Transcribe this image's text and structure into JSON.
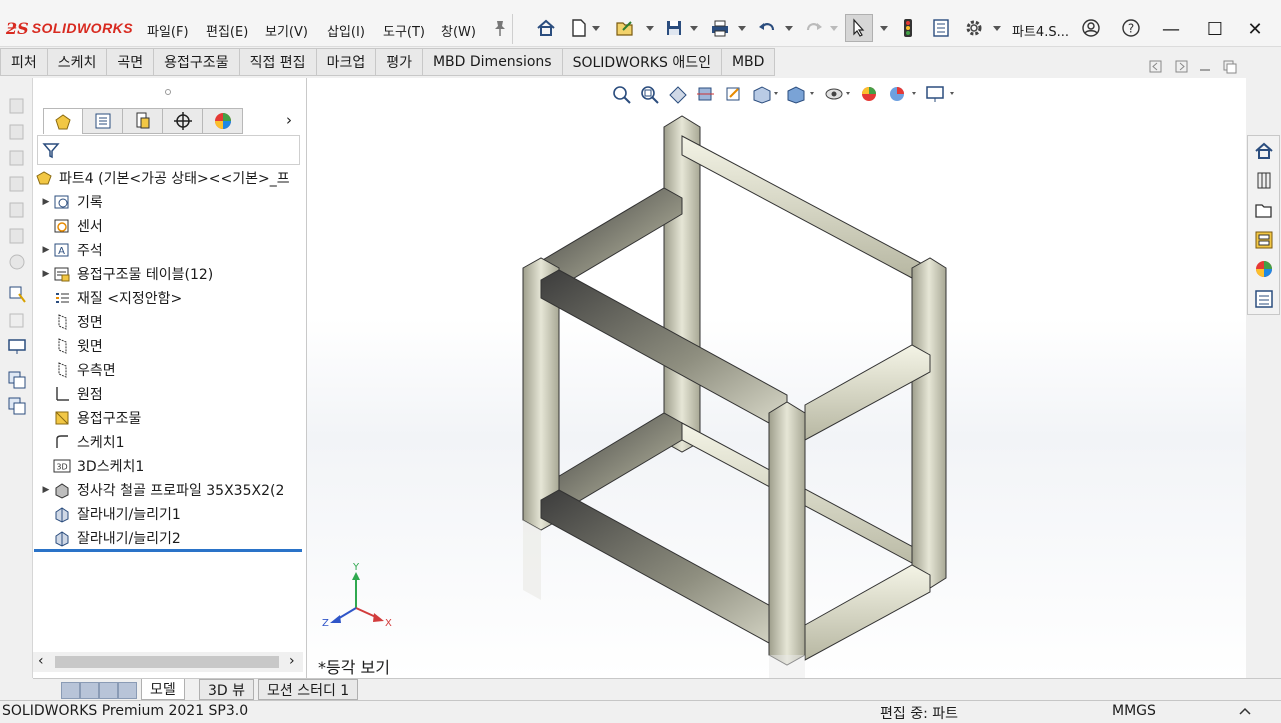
{
  "app": {
    "logo_text": "SOLIDWORKS",
    "window_title": "파트4.S...",
    "colors": {
      "accent": "#2a73c8",
      "logo_red": "#d82a20",
      "frame_metal": "#b9b9a6"
    }
  },
  "menu": [
    "파일(F)",
    "편집(E)",
    "보기(V)",
    "삽입(I)",
    "도구(T)",
    "창(W)"
  ],
  "toolbar_icons": [
    "home-icon",
    "new-document-icon",
    "open-icon",
    "save-icon",
    "print-icon",
    "undo-icon",
    "redo-icon",
    "select-pointer-icon",
    "traffic-light-icon",
    "options-list-icon",
    "gear-icon"
  ],
  "window_controls": {
    "minimize": "—",
    "maximize": "☐",
    "close": "✕"
  },
  "command_tabs": [
    "피처",
    "스케치",
    "곡면",
    "용접구조물",
    "직접 편집",
    "마크업",
    "평가",
    "MBD Dimensions",
    "SOLIDWORKS 애드인",
    "MBD"
  ],
  "feature_tree": {
    "root": "파트4  (기본<가공 상태><<기본>_프",
    "items": [
      {
        "label": "기록",
        "expandable": true,
        "icon": "history-icon"
      },
      {
        "label": "센서",
        "expandable": false,
        "icon": "sensor-icon"
      },
      {
        "label": "주석",
        "expandable": true,
        "icon": "annotation-icon"
      },
      {
        "label": "용접구조물 테이블(12)",
        "expandable": true,
        "icon": "cut-list-icon"
      },
      {
        "label": "재질 <지정안함>",
        "expandable": false,
        "icon": "material-icon"
      },
      {
        "label": "정면",
        "expandable": false,
        "icon": "plane-icon"
      },
      {
        "label": "윗면",
        "expandable": false,
        "icon": "plane-icon"
      },
      {
        "label": "우측면",
        "expandable": false,
        "icon": "plane-icon"
      },
      {
        "label": "원점",
        "expandable": false,
        "icon": "origin-icon"
      },
      {
        "label": "용접구조물",
        "expandable": false,
        "icon": "weldment-icon"
      },
      {
        "label": "스케치1",
        "expandable": false,
        "icon": "sketch-icon"
      },
      {
        "label": "3D스케치1",
        "expandable": false,
        "icon": "sketch-3d-icon"
      },
      {
        "label": "정사각 철골 프로파일 35X35X2(2",
        "expandable": true,
        "icon": "structural-member-icon"
      },
      {
        "label": "잘라내기/늘리기1",
        "expandable": false,
        "icon": "trim-extend-icon"
      },
      {
        "label": "잘라내기/늘리기2",
        "expandable": false,
        "icon": "trim-extend-icon"
      }
    ]
  },
  "viewport": {
    "view_label": "*등각 보기",
    "triad": {
      "x": "X",
      "y": "Y",
      "z": "Z"
    }
  },
  "bottom_tabs": [
    "모델",
    "3D 뷰",
    "모션 스터디 1"
  ],
  "status": {
    "product": "SOLIDWORKS Premium 2021 SP3.0",
    "mode": "편집 중: 파트",
    "units": "MMGS"
  }
}
